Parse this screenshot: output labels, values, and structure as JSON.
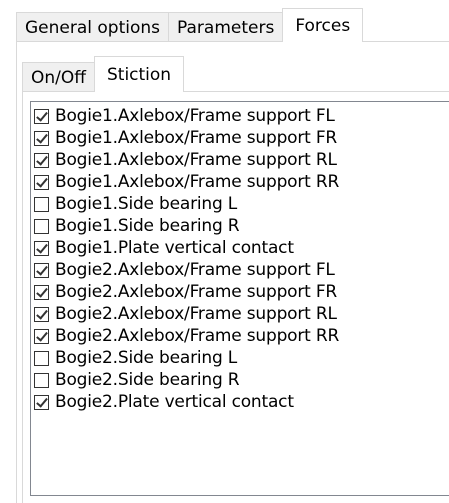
{
  "outer_tabs": [
    {
      "label": "General options",
      "active": false
    },
    {
      "label": "Parameters",
      "active": false
    },
    {
      "label": "Forces",
      "active": true
    }
  ],
  "inner_tabs": [
    {
      "label": "On/Off",
      "active": false
    },
    {
      "label": "Stiction",
      "active": true
    }
  ],
  "items": [
    {
      "label": "Bogie1.Axlebox/Frame support FL",
      "checked": true
    },
    {
      "label": "Bogie1.Axlebox/Frame support FR",
      "checked": true
    },
    {
      "label": "Bogie1.Axlebox/Frame support RL",
      "checked": true
    },
    {
      "label": "Bogie1.Axlebox/Frame support RR",
      "checked": true
    },
    {
      "label": "Bogie1.Side bearing L",
      "checked": false
    },
    {
      "label": "Bogie1.Side bearing R",
      "checked": false
    },
    {
      "label": "Bogie1.Plate vertical contact",
      "checked": true
    },
    {
      "label": "Bogie2.Axlebox/Frame support FL",
      "checked": true
    },
    {
      "label": "Bogie2.Axlebox/Frame support FR",
      "checked": true
    },
    {
      "label": "Bogie2.Axlebox/Frame support RL",
      "checked": true
    },
    {
      "label": "Bogie2.Axlebox/Frame support RR",
      "checked": true
    },
    {
      "label": "Bogie2.Side bearing L",
      "checked": false
    },
    {
      "label": "Bogie2.Side bearing R",
      "checked": false
    },
    {
      "label": "Bogie2.Plate vertical contact",
      "checked": true
    }
  ]
}
